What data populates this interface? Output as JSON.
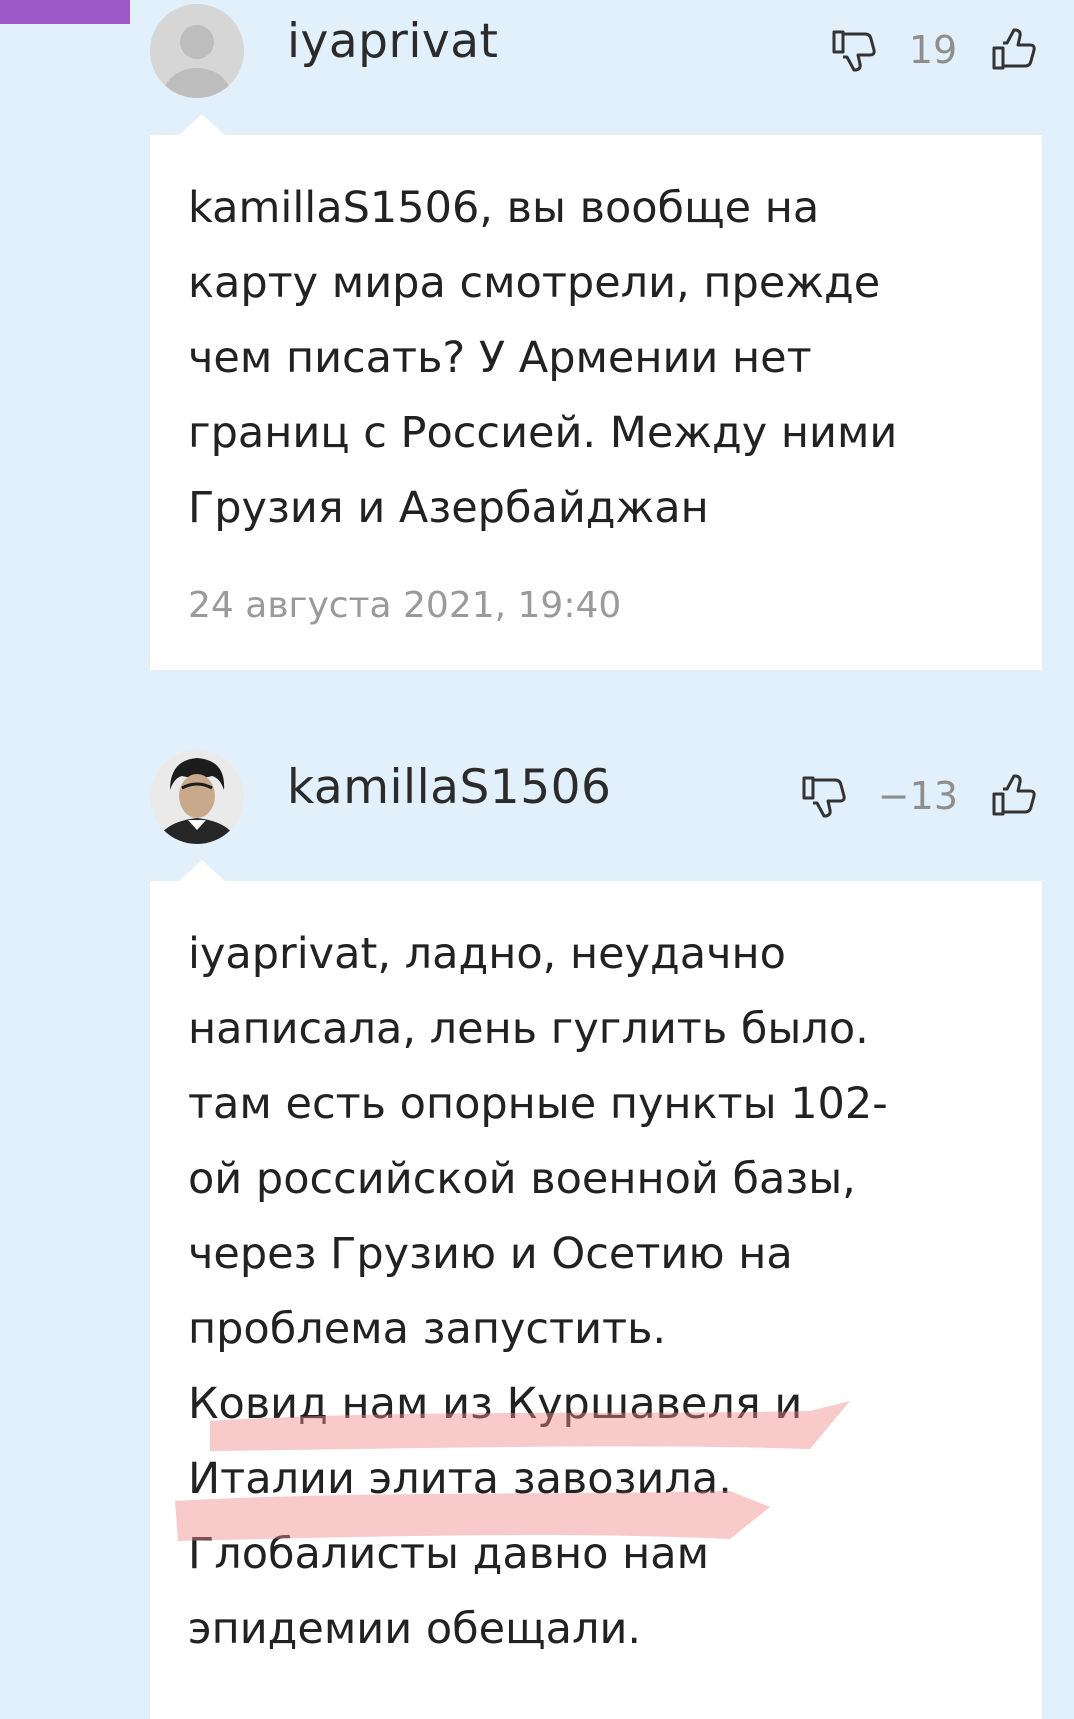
{
  "comments": [
    {
      "username": "iyaprivat",
      "score": "19",
      "text": "kamillaS1506, вы вообще на\nкарту мира смотрели, прежде\nчем писать? У Армении нет\nграниц с Россией. Между ними\nГрузия и Азербайджан",
      "date": "24 августа 2021, 19:40",
      "avatar": "default-user-avatar"
    },
    {
      "username": "kamillaS1506",
      "score": "−13",
      "text": "iyaprivat, ладно, неудачно\nнаписала, лень гуглить было.\nтам есть опорные пункты 102-\nой российской военной базы,\nчерез Грузию и Осетию на\nпроблема запустить.\nКовид нам из Куршавеля и\nИталии элита завозила.\nГлобалисты давно нам\nэпидемии обещали.",
      "avatar": "user-photo-avatar"
    }
  ],
  "icons": {
    "dislike": "thumbs-down-icon",
    "like": "thumbs-up-icon"
  },
  "colors": {
    "background": "#e2f0fc",
    "highlight": "#f08a8a",
    "accent_bar": "#9b59c7"
  }
}
